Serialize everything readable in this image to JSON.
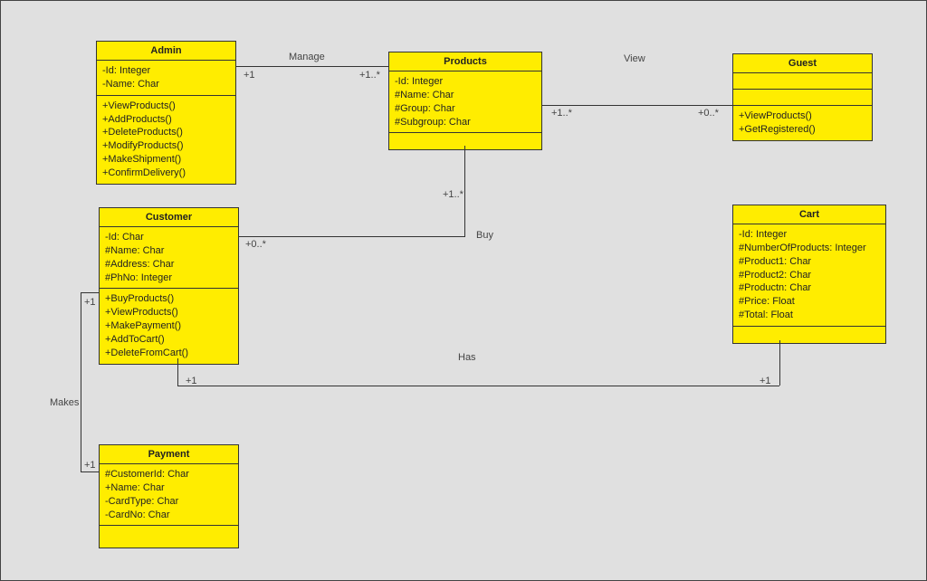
{
  "classes": {
    "admin": {
      "name": "Admin",
      "attrs": [
        "-Id: Integer",
        "-Name: Char"
      ],
      "ops": [
        "+ViewProducts()",
        "+AddProducts()",
        "+DeleteProducts()",
        "+ModifyProducts()",
        "+MakeShipment()",
        "+ConfirmDelivery()"
      ]
    },
    "products": {
      "name": "Products",
      "attrs": [
        "-Id: Integer",
        "#Name: Char",
        "#Group: Char",
        "#Subgroup: Char"
      ],
      "ops": []
    },
    "guest": {
      "name": "Guest",
      "attrs": [],
      "ops": [
        "+ViewProducts()",
        "+GetRegistered()"
      ]
    },
    "customer": {
      "name": "Customer",
      "attrs": [
        "-Id: Char",
        "#Name: Char",
        "#Address: Char",
        "#PhNo: Integer"
      ],
      "ops": [
        "+BuyProducts()",
        "+ViewProducts()",
        "+MakePayment()",
        "+AddToCart()",
        "+DeleteFromCart()"
      ]
    },
    "cart": {
      "name": "Cart",
      "attrs": [
        "-Id: Integer",
        "#NumberOfProducts: Integer",
        "#Product1: Char",
        "#Product2: Char",
        "#Productn: Char",
        "#Price: Float",
        "#Total: Float"
      ],
      "ops": []
    },
    "payment": {
      "name": "Payment",
      "attrs": [
        "#CustomerId: Char",
        "+Name: Char",
        "-CardType: Char",
        "-CardNo: Char"
      ],
      "ops": []
    }
  },
  "relations": {
    "manage": {
      "label": "Manage",
      "m1": "+1",
      "m2": "+1..*"
    },
    "view": {
      "label": "View",
      "m1": "+1..*",
      "m2": "+0..*"
    },
    "buy": {
      "label": "Buy",
      "m1": "+0..*",
      "m2": "+1..*"
    },
    "has": {
      "label": "Has",
      "m1": "+1",
      "m2": "+1"
    },
    "makes": {
      "label": "Makes",
      "m1": "+1",
      "m2": "+1"
    }
  }
}
